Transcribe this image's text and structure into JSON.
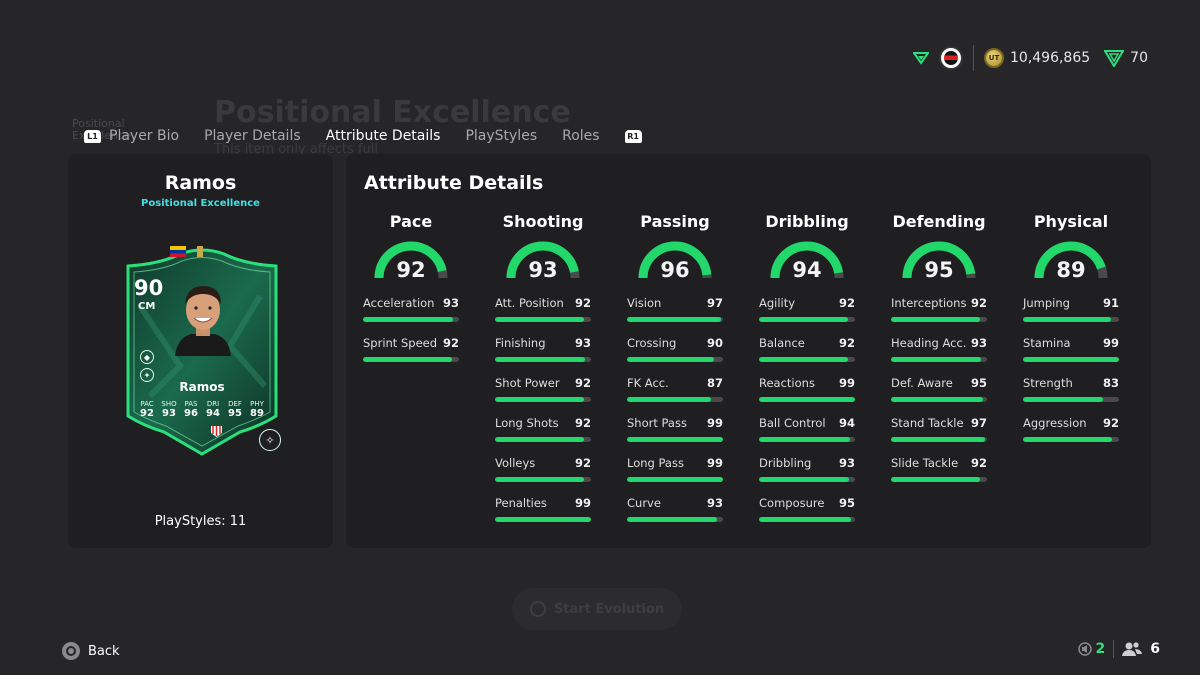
{
  "background": {
    "title": "Positional Excellence",
    "side_label": "Positional Excellence",
    "description": "This item only affects full",
    "start_button": "Start Evolution"
  },
  "topbar": {
    "coins": "10,496,865",
    "points": "70",
    "coin_label": "UT"
  },
  "tabs": {
    "left_hint": "L1",
    "right_hint": "R1",
    "items": [
      "Player Bio",
      "Player Details",
      "Attribute Details",
      "PlayStyles",
      "Roles"
    ],
    "active": "Attribute Details"
  },
  "player": {
    "name": "Ramos",
    "evolution": "Positional Excellence",
    "playstyles_label": "PlayStyles: 11",
    "card": {
      "rating": "90",
      "position": "CM",
      "name": "Ramos",
      "stats": [
        {
          "label": "PAC",
          "value": "92"
        },
        {
          "label": "SHO",
          "value": "93"
        },
        {
          "label": "PAS",
          "value": "96"
        },
        {
          "label": "DRI",
          "value": "94"
        },
        {
          "label": "DEF",
          "value": "95"
        },
        {
          "label": "PHY",
          "value": "89"
        }
      ]
    }
  },
  "attributes": {
    "title": "Attribute Details",
    "accent_color": "#22d86a",
    "categories": [
      {
        "name": "Pace",
        "value": "92",
        "stats": [
          {
            "name": "Acceleration",
            "value": "93"
          },
          {
            "name": "Sprint Speed",
            "value": "92"
          }
        ]
      },
      {
        "name": "Shooting",
        "value": "93",
        "stats": [
          {
            "name": "Att. Position",
            "value": "92"
          },
          {
            "name": "Finishing",
            "value": "93"
          },
          {
            "name": "Shot Power",
            "value": "92"
          },
          {
            "name": "Long Shots",
            "value": "92"
          },
          {
            "name": "Volleys",
            "value": "92"
          },
          {
            "name": "Penalties",
            "value": "99"
          }
        ]
      },
      {
        "name": "Passing",
        "value": "96",
        "stats": [
          {
            "name": "Vision",
            "value": "97"
          },
          {
            "name": "Crossing",
            "value": "90"
          },
          {
            "name": "FK Acc.",
            "value": "87"
          },
          {
            "name": "Short Pass",
            "value": "99"
          },
          {
            "name": "Long Pass",
            "value": "99"
          },
          {
            "name": "Curve",
            "value": "93"
          }
        ]
      },
      {
        "name": "Dribbling",
        "value": "94",
        "stats": [
          {
            "name": "Agility",
            "value": "92"
          },
          {
            "name": "Balance",
            "value": "92"
          },
          {
            "name": "Reactions",
            "value": "99"
          },
          {
            "name": "Ball Control",
            "value": "94"
          },
          {
            "name": "Dribbling",
            "value": "93"
          },
          {
            "name": "Composure",
            "value": "95"
          }
        ]
      },
      {
        "name": "Defending",
        "value": "95",
        "stats": [
          {
            "name": "Interceptions",
            "value": "92"
          },
          {
            "name": "Heading Acc.",
            "value": "93"
          },
          {
            "name": "Def. Aware",
            "value": "95"
          },
          {
            "name": "Stand Tackle",
            "value": "97"
          },
          {
            "name": "Slide Tackle",
            "value": "92"
          }
        ]
      },
      {
        "name": "Physical",
        "value": "89",
        "stats": [
          {
            "name": "Jumping",
            "value": "91"
          },
          {
            "name": "Stamina",
            "value": "99"
          },
          {
            "name": "Strength",
            "value": "83"
          },
          {
            "name": "Aggression",
            "value": "92"
          }
        ]
      }
    ]
  },
  "footer": {
    "back_label": "Back",
    "count_a": "2",
    "count_b": "6"
  }
}
